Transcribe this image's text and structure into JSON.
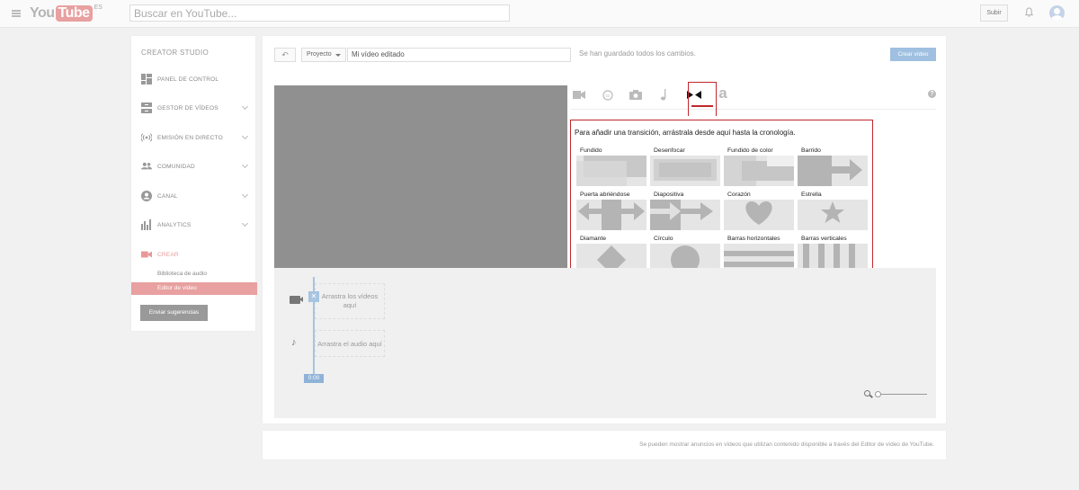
{
  "topbar": {
    "logo_you": "You",
    "logo_tube": "Tube",
    "logo_country": "ES",
    "search_placeholder": "Buscar en YouTube...",
    "upload_label": "Subir",
    "icons": [
      "menu-icon",
      "bell-icon",
      "avatar"
    ]
  },
  "sidebar": {
    "title": "CREATOR STUDIO",
    "items": [
      {
        "label": "PANEL DE CONTROL",
        "icon": "dashboard-icon",
        "chevron": false
      },
      {
        "label": "GESTOR DE VÍDEOS",
        "icon": "video-manager-icon",
        "chevron": true
      },
      {
        "label": "EMISIÓN EN DIRECTO",
        "icon": "live-icon",
        "chevron": true
      },
      {
        "label": "COMUNIDAD",
        "icon": "community-icon",
        "chevron": true
      },
      {
        "label": "CANAL",
        "icon": "channel-icon",
        "chevron": true
      },
      {
        "label": "ANALYTICS",
        "icon": "analytics-icon",
        "chevron": true
      },
      {
        "label": "CREAR",
        "icon": "camera-icon",
        "chevron": false
      }
    ],
    "subitems": [
      {
        "label": "Biblioteca de audio"
      },
      {
        "label": "Editor de vídeo"
      }
    ],
    "feedback_label": "Enviar sugerencias",
    "active_color": "#e8a0a0"
  },
  "editor": {
    "undo_label": "↶",
    "project_label": "Proyecto",
    "title_value": "Mi vídeo editado",
    "saved_status": "Se han guardado todos los cambios.",
    "create_label": "Crear vídeo",
    "tabs": [
      {
        "icon": "video-icon",
        "glyph": "■"
      },
      {
        "icon": "cc-icon",
        "glyph": "©"
      },
      {
        "icon": "photo-icon",
        "glyph": "◙"
      },
      {
        "icon": "music-icon",
        "glyph": "♪"
      },
      {
        "icon": "transitions-icon",
        "glyph": "⧓"
      },
      {
        "icon": "text-icon",
        "glyph": "a"
      }
    ],
    "active_tab": "transitions",
    "help_label": "?",
    "highlight_color": "#c0272d"
  },
  "transitions": {
    "instruction": "Para añadir una transición, arrástrala desde aquí hasta la cronología.",
    "items": [
      {
        "label": "Fundido",
        "preview": "fade"
      },
      {
        "label": "Desenfocar",
        "preview": "blur"
      },
      {
        "label": "Fundido de color",
        "preview": "color-fade"
      },
      {
        "label": "Barrido",
        "preview": "wipe"
      },
      {
        "label": "Puerta abriéndose",
        "preview": "door"
      },
      {
        "label": "Diapositiva",
        "preview": "slide"
      },
      {
        "label": "Corazón",
        "preview": "heart"
      },
      {
        "label": "Estrella",
        "preview": "star"
      },
      {
        "label": "Diamante",
        "preview": "diamond"
      },
      {
        "label": "Círculo",
        "preview": "circle"
      },
      {
        "label": "Barras horizontales",
        "preview": "hbars"
      },
      {
        "label": "Barras verticales",
        "preview": "vbars"
      }
    ]
  },
  "timeline": {
    "video_drop": "Arrastra los vídeos aquí",
    "audio_drop": "Arrastra el audio aquí",
    "time": "0:00",
    "playhead_marker": "✕"
  },
  "footer": {
    "text": "Se pueden mostrar anuncios en vídeos que utilizan contenido disponible a través del Editor de vídeo de YouTube."
  }
}
